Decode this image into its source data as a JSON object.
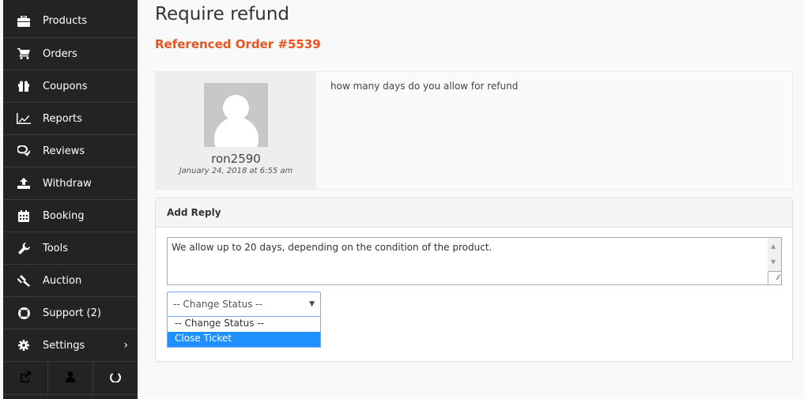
{
  "sidebar": {
    "items": [
      {
        "label": "Products",
        "icon": "briefcase-icon"
      },
      {
        "label": "Orders",
        "icon": "cart-icon"
      },
      {
        "label": "Coupons",
        "icon": "gift-icon"
      },
      {
        "label": "Reports",
        "icon": "chart-line-icon"
      },
      {
        "label": "Reviews",
        "icon": "comments-icon"
      },
      {
        "label": "Withdraw",
        "icon": "upload-icon"
      },
      {
        "label": "Booking",
        "icon": "calendar-icon"
      },
      {
        "label": "Tools",
        "icon": "wrench-icon"
      },
      {
        "label": "Auction",
        "icon": "gavel-icon"
      },
      {
        "label": "Support (2)",
        "icon": "lifebuoy-icon"
      },
      {
        "label": "Settings",
        "icon": "gear-icon",
        "chevron": "›"
      }
    ],
    "bottom": [
      "external-link-icon",
      "user-icon",
      "power-icon"
    ]
  },
  "page": {
    "title": "Require refund",
    "referenced_order": "Referenced Order #5539"
  },
  "comment": {
    "author": "ron2590",
    "date": "January 24, 2018 at 6:55 am",
    "text": "how many days do you allow for refund"
  },
  "reply": {
    "heading": "Add Reply",
    "textarea_value": "We allow up to 20 days, depending on the condition of the product.",
    "status_select": {
      "selected": "-- Change Status --",
      "options": [
        "-- Change Status --",
        "Close Ticket"
      ],
      "highlighted": "Close Ticket"
    }
  }
}
